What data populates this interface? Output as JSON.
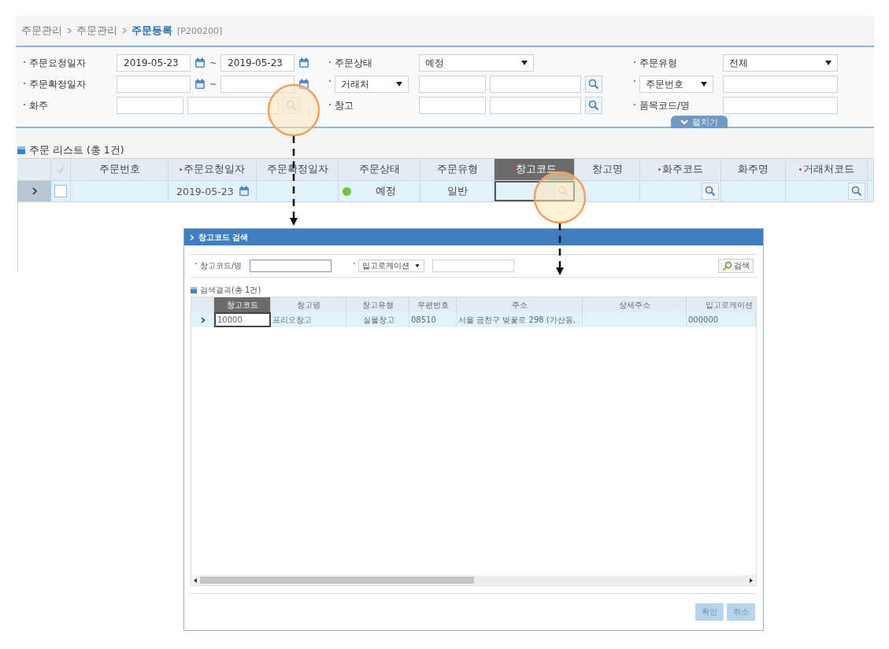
{
  "breadcrumb": [
    {
      "text": "주문관리",
      "current": false
    },
    {
      "text": "주문관리",
      "current": false
    },
    {
      "text": "주문등록",
      "current": true
    }
  ],
  "screen_id": "[P200200]",
  "filters": [
    {
      "label": {
        "text": "주문요청일자",
        "dropdown": false
      },
      "kind": "date_range",
      "values": [
        "2019-05-23",
        "2019-05-23"
      ],
      "separator": "~"
    },
    {
      "label": {
        "text": "주문상태",
        "dropdown": false
      },
      "kind": "select",
      "value": "예정"
    },
    {
      "label": {
        "text": "주문유형",
        "dropdown": false
      },
      "kind": "select",
      "value": "전체"
    },
    {
      "label": {
        "text": "주문확정일자",
        "dropdown": false
      },
      "kind": "date_range",
      "separator": "~"
    },
    {
      "label": {
        "text": "거래처",
        "dropdown": true
      },
      "kind": "lookup"
    },
    {
      "label": {
        "text": "주문번호",
        "dropdown": true
      },
      "kind": "text"
    },
    {
      "label": {
        "text": "화주",
        "dropdown": false
      },
      "kind": "lookup"
    },
    {
      "label": {
        "text": "창고",
        "dropdown": false
      },
      "kind": "lookup"
    },
    {
      "label": {
        "text": "품목코드/명",
        "dropdown": false
      },
      "kind": "text"
    }
  ],
  "expand_toggle": "펼치기",
  "order_list": {
    "title": "주문 리스트 (총 1건)",
    "columns": [
      {
        "label": "주문번호",
        "required": false,
        "selected": false
      },
      {
        "label": "주문요청일자",
        "required": true,
        "selected": false
      },
      {
        "label": "주문확정일자",
        "required": false,
        "selected": false
      },
      {
        "label": "주문상태",
        "required": false,
        "selected": false
      },
      {
        "label": "주문유형",
        "required": false,
        "selected": false
      },
      {
        "label": "창고코드",
        "required": true,
        "selected": true
      },
      {
        "label": "창고명",
        "required": false,
        "selected": false
      },
      {
        "label": "화주코드",
        "required": true,
        "selected": false
      },
      {
        "label": "화주명",
        "required": false,
        "selected": false
      },
      {
        "label": "거래처코드",
        "required": true,
        "selected": false
      }
    ],
    "rows": [
      {
        "checked": false,
        "cells": [
          {
            "kind": "empty"
          },
          {
            "kind": "date",
            "text": "2019-05-23"
          },
          {
            "kind": "empty"
          },
          {
            "kind": "status",
            "text": "예정",
            "color": "#77c142"
          },
          {
            "kind": "text",
            "text": "일반"
          },
          {
            "kind": "lookup",
            "focused": true
          },
          {
            "kind": "empty"
          },
          {
            "kind": "lookup",
            "focused": false
          },
          {
            "kind": "empty"
          },
          {
            "kind": "lookup",
            "focused": false
          }
        ]
      }
    ]
  },
  "dialog": {
    "title": "창고코드 검색",
    "filters": [
      {
        "label": {
          "text": "창고코드/명",
          "dropdown": false
        },
        "focused": true
      },
      {
        "label": {
          "text": "입고로케이션",
          "dropdown": true
        },
        "focused": false
      }
    ],
    "search_button": "검색",
    "result_title": "검색결과(총 1건)",
    "columns": [
      {
        "label": "창고코드",
        "selected": true
      },
      {
        "label": "창고명",
        "selected": false
      },
      {
        "label": "창고유형",
        "selected": false
      },
      {
        "label": "우편번호",
        "selected": false
      },
      {
        "label": "주소",
        "selected": false
      },
      {
        "label": "상세주소",
        "selected": false
      },
      {
        "label": "입고로케이션",
        "selected": false
      }
    ],
    "rows": [
      {
        "cells": [
          "10000",
          "프리오창고",
          "실물창고",
          "08510",
          "서울 금천구 벚꽃로 298 (가산동,",
          "",
          "000000"
        ]
      }
    ],
    "buttons": [
      {
        "label": "확인",
        "disabled": true
      },
      {
        "label": "취소",
        "disabled": true
      }
    ]
  }
}
